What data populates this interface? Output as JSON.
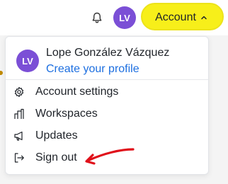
{
  "header": {
    "avatar_initials": "LV",
    "account_label": "Account",
    "notification_icon": "bell-icon",
    "caret_icon": "chevron-up-icon"
  },
  "menu": {
    "user_name": "Lope González Vázquez",
    "avatar_initials": "LV",
    "profile_link": "Create your profile",
    "items": [
      {
        "label": "Account settings",
        "icon": "gear-icon"
      },
      {
        "label": "Workspaces",
        "icon": "workspaces-icon"
      },
      {
        "label": "Updates",
        "icon": "megaphone-icon"
      },
      {
        "label": "Sign out",
        "icon": "sign-out-icon"
      }
    ]
  },
  "colors": {
    "avatar": "#7b4fd6",
    "link": "#1d6fe0",
    "highlight": "#f7ef1a",
    "annotation_arrow": "#e0101a"
  }
}
